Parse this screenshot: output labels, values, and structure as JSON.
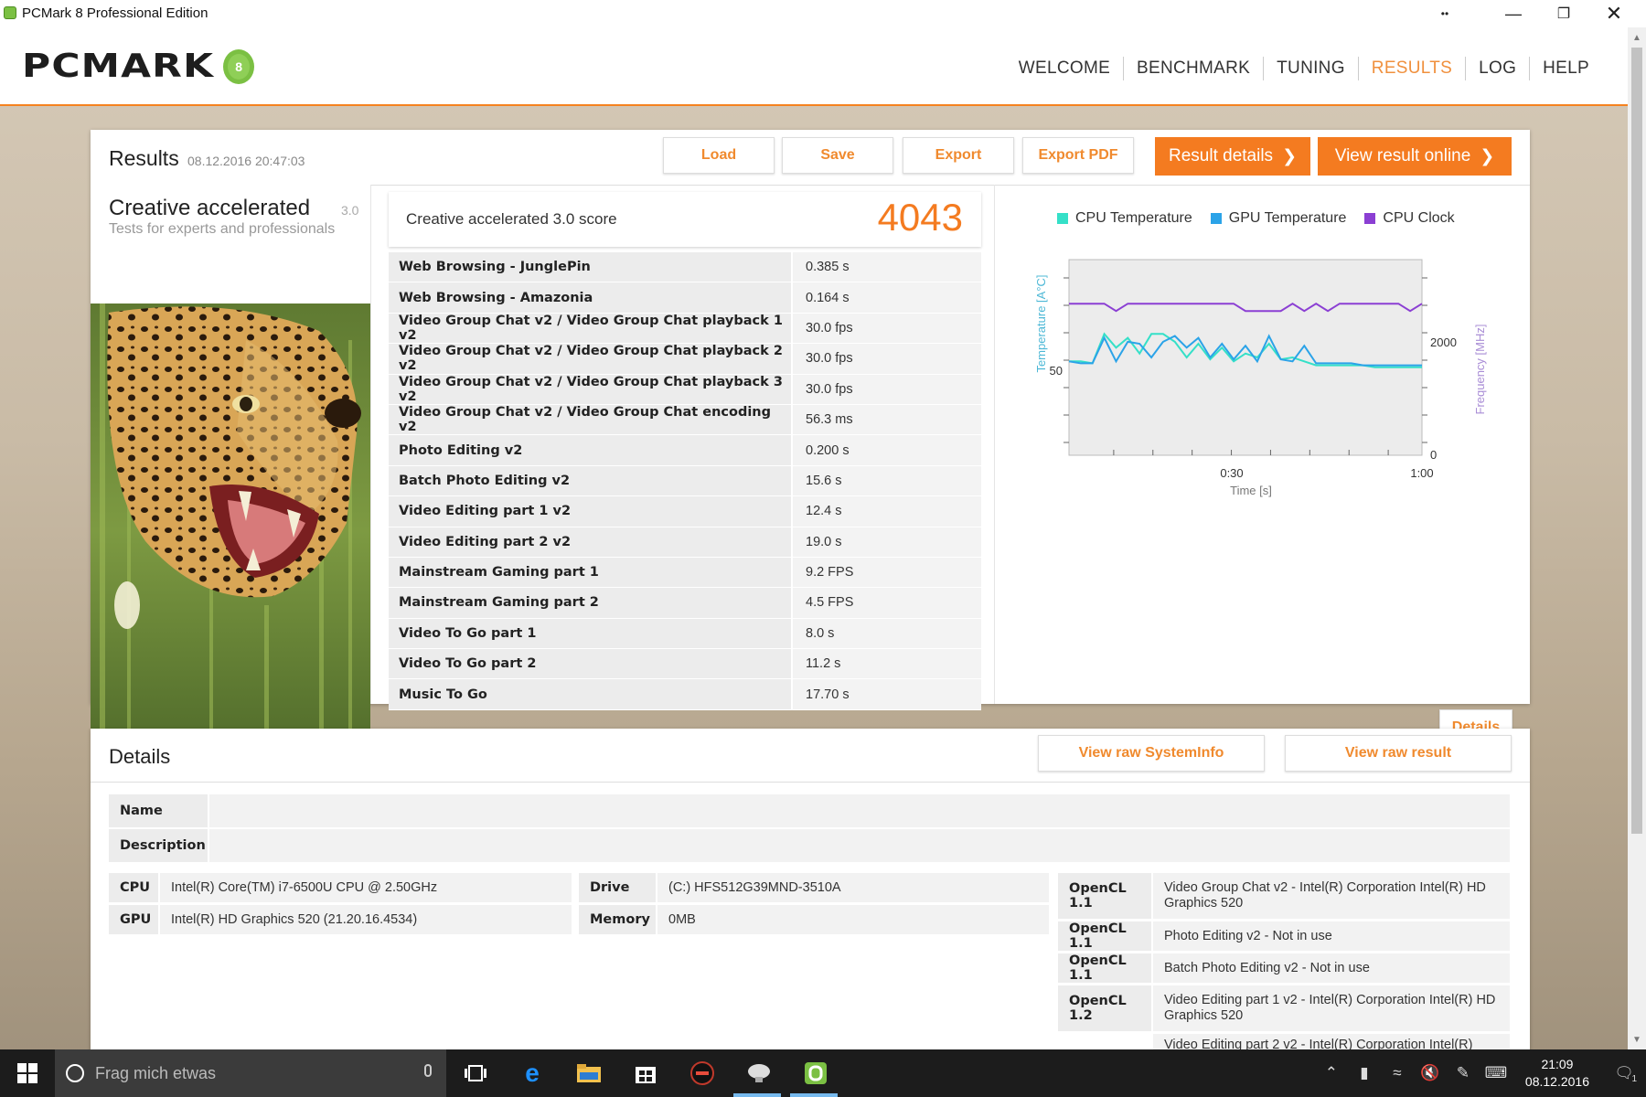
{
  "window": {
    "title": "PCMark 8 Professional Edition"
  },
  "header": {
    "logo": "PCMARK",
    "nav": [
      {
        "label": "WELCOME",
        "active": false
      },
      {
        "label": "BENCHMARK",
        "active": false
      },
      {
        "label": "TUNING",
        "active": false
      },
      {
        "label": "RESULTS",
        "active": true
      },
      {
        "label": "LOG",
        "active": false
      },
      {
        "label": "HELP",
        "active": false
      }
    ]
  },
  "results": {
    "title": "Results",
    "date": "08.12.2016 20:47:03",
    "buttons": {
      "load": "Load",
      "save": "Save",
      "export": "Export",
      "export_pdf": "Export PDF",
      "result_details": "Result details",
      "view_online": "View result online"
    },
    "test": {
      "name": "Creative accelerated",
      "version": "3.0",
      "subtitle": "Tests for experts and professionals"
    },
    "score": {
      "label": "Creative accelerated 3.0 score",
      "value": "4043"
    },
    "rows": [
      {
        "name": "Web Browsing - JunglePin",
        "value": "0.385 s"
      },
      {
        "name": "Web Browsing - Amazonia",
        "value": "0.164 s"
      },
      {
        "name": "Video Group Chat v2 / Video Group Chat playback 1 v2",
        "value": "30.0 fps"
      },
      {
        "name": "Video Group Chat v2 / Video Group Chat playback 2 v2",
        "value": "30.0 fps"
      },
      {
        "name": "Video Group Chat v2 / Video Group Chat playback 3 v2",
        "value": "30.0 fps"
      },
      {
        "name": "Video Group Chat v2 / Video Group Chat encoding v2",
        "value": "56.3 ms"
      },
      {
        "name": "Photo Editing v2",
        "value": "0.200 s"
      },
      {
        "name": "Batch Photo Editing v2",
        "value": "15.6 s"
      },
      {
        "name": "Video Editing part 1 v2",
        "value": "12.4 s"
      },
      {
        "name": "Video Editing part 2 v2",
        "value": "19.0 s"
      },
      {
        "name": "Mainstream Gaming part 1",
        "value": "9.2 FPS"
      },
      {
        "name": "Mainstream Gaming part 2",
        "value": "4.5 FPS"
      },
      {
        "name": "Video To Go part 1",
        "value": "8.0 s"
      },
      {
        "name": "Video To Go part 2",
        "value": "11.2 s"
      },
      {
        "name": "Music To Go",
        "value": "17.70 s"
      }
    ],
    "details_button": "Details"
  },
  "chart_data": {
    "type": "line",
    "title": "",
    "xlabel": "Time [s]",
    "ylabel": "Temperature [A°C]",
    "y2label": "Frequency [MHz]",
    "xlim": [
      0,
      60
    ],
    "ylim": [
      0,
      100
    ],
    "y2lim": [
      0,
      4000
    ],
    "x_ticks": [
      "0:30",
      "1:00"
    ],
    "y_ticks": [
      "50"
    ],
    "y2_ticks": [
      "2000",
      "0"
    ],
    "legend_position": "top",
    "series": [
      {
        "name": "CPU Temperature",
        "color": "#35e0c8",
        "axis": "left",
        "x": [
          0,
          2,
          4,
          6,
          8,
          10,
          12,
          14,
          16,
          18,
          20,
          22,
          24,
          26,
          28,
          30,
          32,
          34,
          36,
          38,
          40,
          42,
          44,
          46,
          48,
          50,
          52,
          54,
          56,
          58,
          60
        ],
        "values": [
          48,
          48,
          47,
          62,
          55,
          60,
          52,
          62,
          62,
          58,
          50,
          57,
          49,
          55,
          48,
          52,
          50,
          57,
          49,
          50,
          48,
          46,
          46,
          46,
          46,
          46,
          45,
          45,
          45,
          45,
          45
        ]
      },
      {
        "name": "GPU Temperature",
        "color": "#2ba3e8",
        "axis": "left",
        "x": [
          0,
          2,
          4,
          6,
          8,
          10,
          12,
          14,
          16,
          18,
          20,
          22,
          24,
          26,
          28,
          30,
          32,
          34,
          36,
          38,
          40,
          42,
          44,
          46,
          48,
          50,
          52,
          54,
          56,
          58,
          60
        ],
        "values": [
          48,
          47,
          47,
          60,
          48,
          58,
          57,
          50,
          58,
          61,
          55,
          60,
          50,
          57,
          49,
          56,
          48,
          61,
          49,
          48,
          56,
          47,
          47,
          47,
          47,
          46,
          46,
          46,
          46,
          46,
          46
        ]
      },
      {
        "name": "CPU Clock",
        "color": "#8b3fd3",
        "axis": "right",
        "x": [
          0,
          4,
          6,
          8,
          10,
          12,
          14,
          16,
          18,
          20,
          22,
          24,
          26,
          28,
          30,
          32,
          34,
          36,
          38,
          40,
          42,
          44,
          46,
          48,
          50,
          52,
          54,
          56,
          58,
          60
        ],
        "values": [
          3100,
          3100,
          3100,
          2950,
          3100,
          3100,
          3100,
          3100,
          3100,
          3100,
          3100,
          3100,
          3100,
          3100,
          2950,
          2950,
          2950,
          2950,
          3100,
          2950,
          3100,
          2950,
          3100,
          3100,
          3100,
          3100,
          3100,
          3100,
          2950,
          3100
        ]
      }
    ]
  },
  "details": {
    "title": "Details",
    "buttons": {
      "raw_sysinfo": "View raw SystemInfo",
      "raw_result": "View raw result"
    },
    "name_label": "Name",
    "name_value": "",
    "description_label": "Description",
    "description_value": "",
    "cpu_label": "CPU",
    "cpu_value": "Intel(R) Core(TM) i7-6500U CPU @ 2.50GHz",
    "gpu_label": "GPU",
    "gpu_value": "Intel(R) HD Graphics 520 (21.20.16.4534)",
    "drive_label": "Drive",
    "drive_value": "(C:) HFS512G39MND-3510A",
    "memory_label": "Memory",
    "memory_value": "0MB",
    "opencl": [
      {
        "label": "OpenCL 1.1",
        "value": "Video Group Chat v2 - Intel(R) Corporation Intel(R) HD Graphics 520"
      },
      {
        "label": "OpenCL 1.1",
        "value": "Photo Editing v2 - Not in use"
      },
      {
        "label": "OpenCL 1.1",
        "value": "Batch Photo Editing v2 - Not in use"
      },
      {
        "label": "OpenCL 1.2",
        "value": "Video Editing part 1 v2 - Intel(R) Corporation Intel(R) HD Graphics 520"
      },
      {
        "label": "",
        "value": "Video Editing part 2 v2 - Intel(R) Corporation Intel(R)"
      }
    ]
  },
  "taskbar": {
    "search_placeholder": "Frag mich etwas",
    "time": "21:09",
    "date": "08.12.2016",
    "notification_count": "1"
  },
  "colors": {
    "accent": "#f47b20",
    "nav_active": "#f0903d",
    "logo_green": "#7bc043"
  }
}
